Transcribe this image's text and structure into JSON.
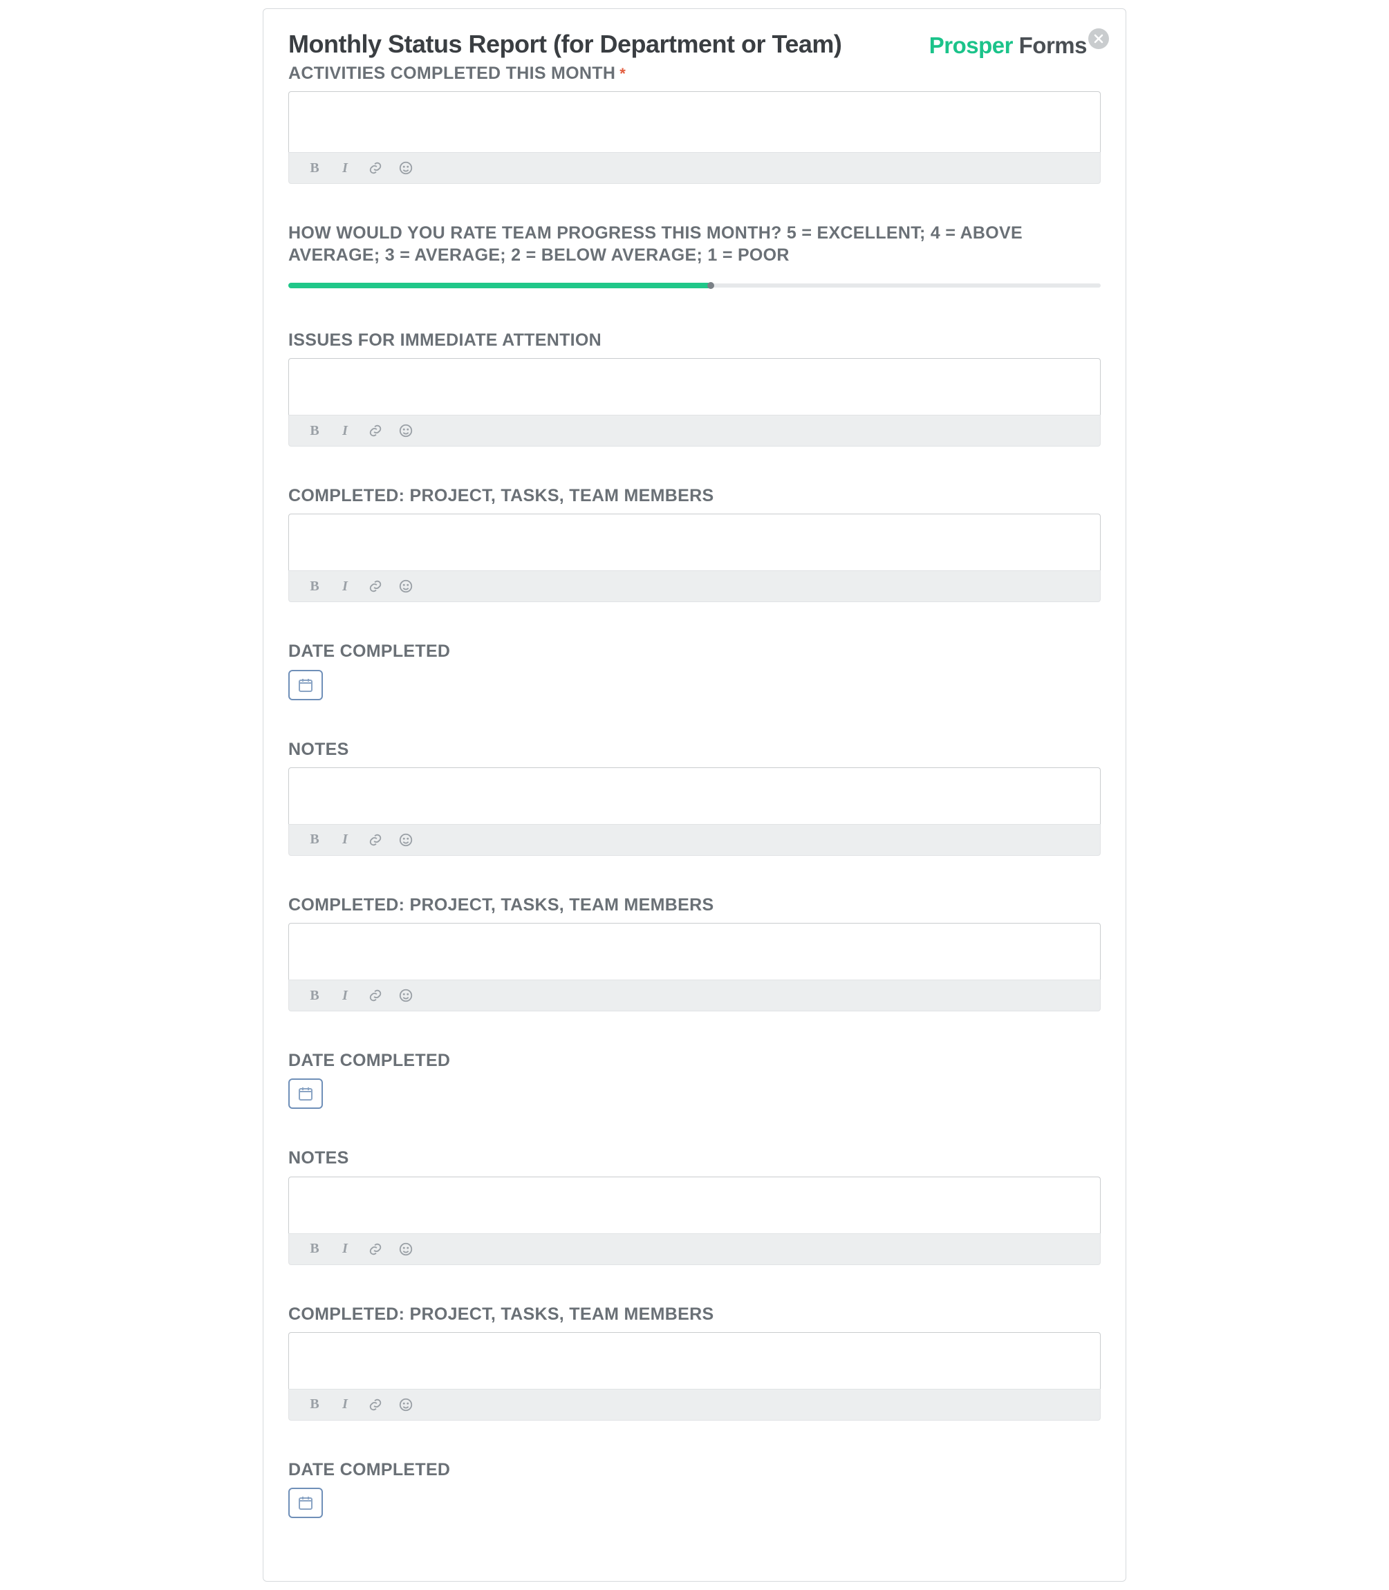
{
  "header": {
    "title": "Monthly Status Report (for Department or Team)",
    "brand1": "Prosper ",
    "brand2": "Forms"
  },
  "slider": {
    "percent": 52
  },
  "sections": [
    {
      "label": "ACTIVITIES COMPLETED THIS MONTH",
      "type": "richtext",
      "required": true
    },
    {
      "label": "HOW WOULD YOU RATE TEAM PROGRESS THIS MONTH? 5 = EXCELLENT; 4 = ABOVE AVERAGE; 3 = AVERAGE; 2 = BELOW AVERAGE; 1 = POOR",
      "type": "slider"
    },
    {
      "label": "ISSUES FOR IMMEDIATE ATTENTION",
      "type": "richtext"
    },
    {
      "label": "COMPLETED: PROJECT, TASKS, TEAM MEMBERS",
      "type": "richtext"
    },
    {
      "label": "DATE COMPLETED",
      "type": "date"
    },
    {
      "label": "NOTES",
      "type": "richtext"
    },
    {
      "label": "COMPLETED: PROJECT, TASKS, TEAM MEMBERS",
      "type": "richtext"
    },
    {
      "label": "DATE COMPLETED",
      "type": "date"
    },
    {
      "label": "NOTES",
      "type": "richtext"
    },
    {
      "label": "COMPLETED: PROJECT, TASKS, TEAM MEMBERS",
      "type": "richtext"
    },
    {
      "label": "DATE COMPLETED",
      "type": "date"
    }
  ],
  "toolbar": {
    "bold": "B",
    "italic": "I"
  }
}
